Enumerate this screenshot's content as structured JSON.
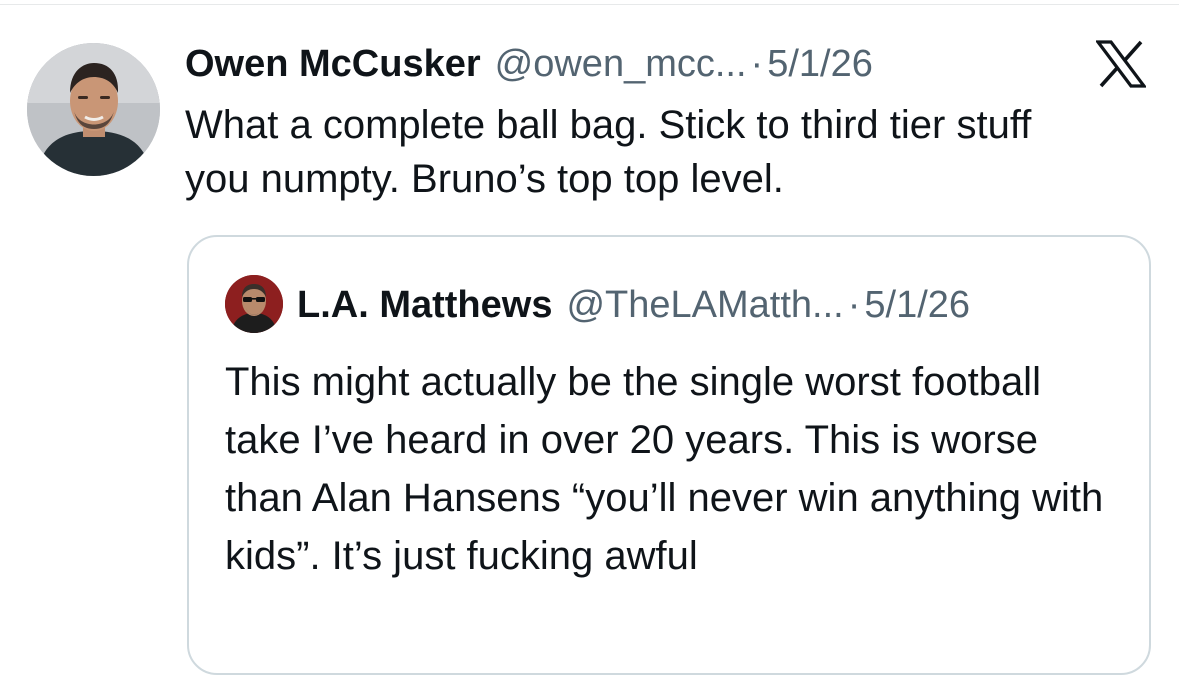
{
  "tweet": {
    "author_name": "Owen McCusker",
    "author_handle": "@owen_mcc...",
    "separator": "·",
    "date": "5/1/26",
    "text": "What a complete ball bag. Stick to third tier stuff you numpty. Bruno’s top top level.",
    "avatar_icon": "user-avatar",
    "platform_icon": "x-logo-icon"
  },
  "quote": {
    "author_name": "L.A. Matthews",
    "author_handle": "@TheLAMatth...",
    "separator": "·",
    "date": "5/1/26",
    "text": "This might actually be the single worst football take I’ve heard in over 20 years. This is worse than Alan Hansens “you’ll never win anything with kids”. It’s just fucking awful",
    "avatar_icon": "user-avatar"
  },
  "colors": {
    "text_primary": "#0f1419",
    "text_secondary": "#536471",
    "border": "#cfd9de",
    "background": "#ffffff"
  }
}
